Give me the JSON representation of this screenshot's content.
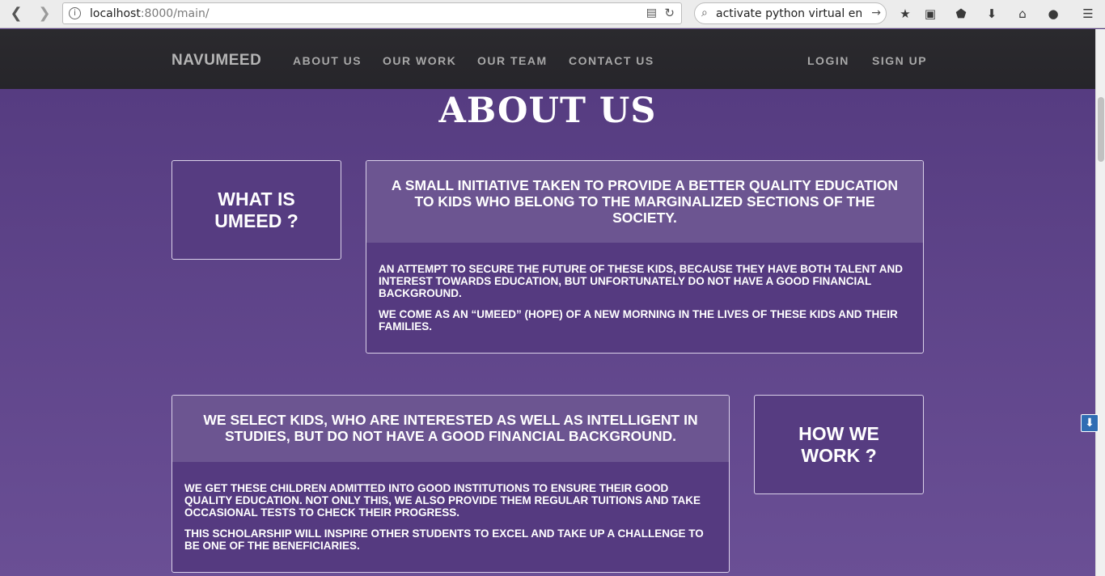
{
  "browser": {
    "url_host": "localhost",
    "url_rest": ":8000/main/",
    "search_value": "activate python virtual env",
    "icons": [
      "back-icon",
      "forward-icon",
      "info-icon",
      "reader-icon",
      "reload-icon",
      "search-icon",
      "go-arrow-icon",
      "bookmark-star-icon",
      "reading-list-icon",
      "pocket-icon",
      "download-icon",
      "home-icon",
      "chat-icon",
      "menu-icon"
    ]
  },
  "nav": {
    "brand": "NAVUMEED",
    "links": [
      "ABOUT US",
      "OUR WORK",
      "OUR TEAM",
      "CONTACT US"
    ],
    "auth": [
      "LOGIN",
      "SIGN UP"
    ]
  },
  "about": {
    "heading": "ABOUT US",
    "what_is": "WHAT IS UMEED ?",
    "intro_head": "A SMALL INITIATIVE TAKEN TO PROVIDE A BETTER QUALITY EDUCATION TO KIDS WHO BELONG TO THE MARGINALIZED SECTIONS OF THE SOCIETY.",
    "intro_p1": "AN ATTEMPT TO SECURE THE FUTURE OF THESE KIDS, BECAUSE THEY HAVE BOTH TALENT AND INTEREST TOWARDS EDUCATION, BUT UNFORTUNATELY DO NOT HAVE A GOOD FINANCIAL BACKGROUND.",
    "intro_p2": "WE COME AS AN “UMEED” (HOPE) OF A NEW MORNING IN THE LIVES OF THESE KIDS AND THEIR FAMILIES.",
    "how_we_work": "HOW WE WORK ?",
    "work_head": "WE SELECT KIDS, WHO ARE INTERESTED AS WELL AS INTELLIGENT IN STUDIES, BUT DO NOT HAVE A GOOD FINANCIAL BACKGROUND.",
    "work_p1": "WE GET THESE CHILDREN ADMITTED INTO GOOD INSTITUTIONS TO ENSURE THEIR GOOD QUALITY EDUCATION. NOT ONLY THIS, WE ALSO PROVIDE THEM REGULAR TUITIONS AND TAKE OCCASIONAL TESTS TO CHECK THEIR PROGRESS.",
    "work_p2": "THIS SCHOLARSHIP WILL INSPIRE OTHER STUDENTS TO EXCEL AND TAKE UP A CHALLENGE TO BE ONE OF THE BENEFICIARIES."
  },
  "colors": {
    "page_bg": "#5d4287",
    "navbar_bg": "#2b2a2e",
    "panel_head": "#6c5591",
    "panel_body": "#553a80"
  }
}
